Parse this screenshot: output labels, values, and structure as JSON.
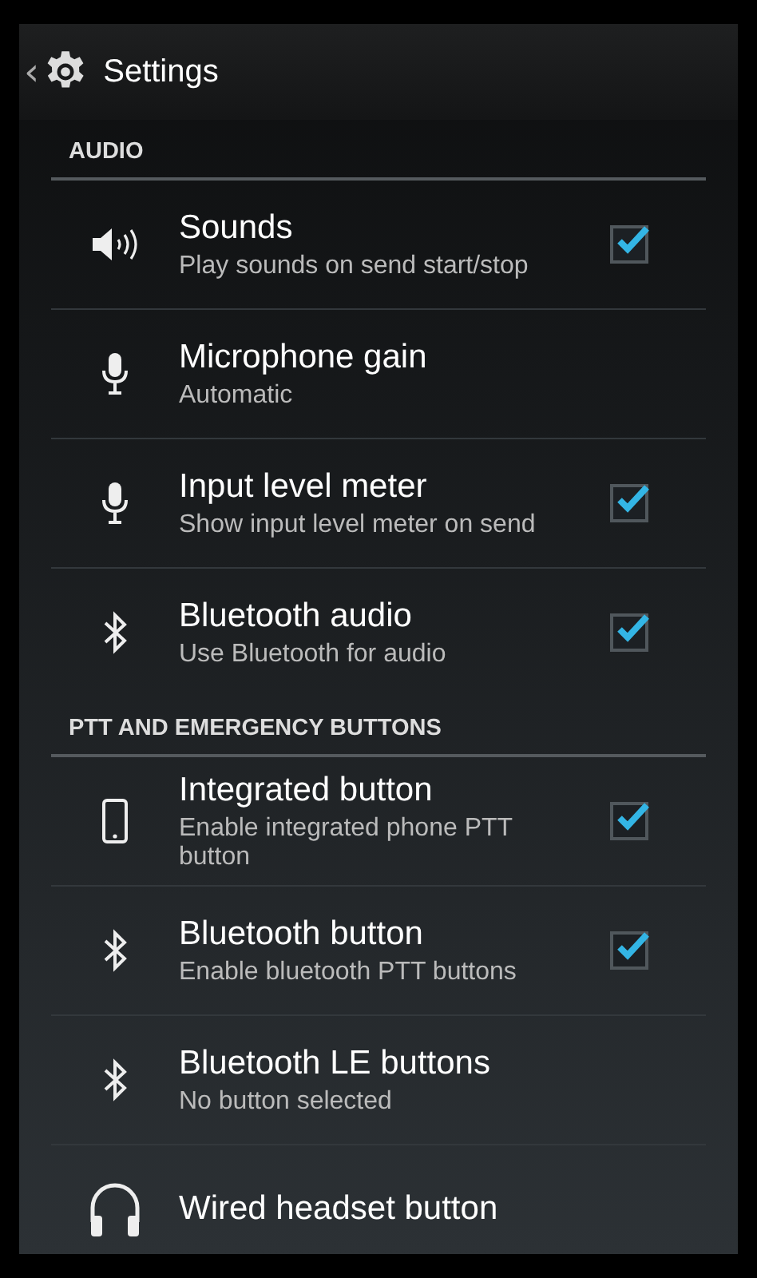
{
  "action_bar": {
    "back": "‹",
    "title": "Settings"
  },
  "sections": [
    {
      "title": "AUDIO",
      "items": [
        {
          "title": "Sounds",
          "summary": "Play sounds on send start/stop",
          "kind": "checkbox",
          "checked": true
        },
        {
          "title": "Microphone gain",
          "summary": "Automatic",
          "kind": "plain"
        },
        {
          "title": "Input level meter",
          "summary": "Show input level meter on send",
          "kind": "checkbox",
          "checked": true
        },
        {
          "title": "Bluetooth audio",
          "summary": "Use Bluetooth for audio",
          "kind": "checkbox",
          "checked": true
        }
      ]
    },
    {
      "title": "PTT AND EMERGENCY BUTTONS",
      "items": [
        {
          "title": "Integrated button",
          "summary": "Enable integrated phone PTT button",
          "kind": "checkbox",
          "checked": true
        },
        {
          "title": "Bluetooth button",
          "summary": "Enable bluetooth PTT buttons",
          "kind": "checkbox",
          "checked": true
        },
        {
          "title": "Bluetooth LE buttons",
          "summary": "No button selected",
          "kind": "plain"
        },
        {
          "title": "Wired headset button",
          "kind": "plain"
        }
      ]
    }
  ]
}
